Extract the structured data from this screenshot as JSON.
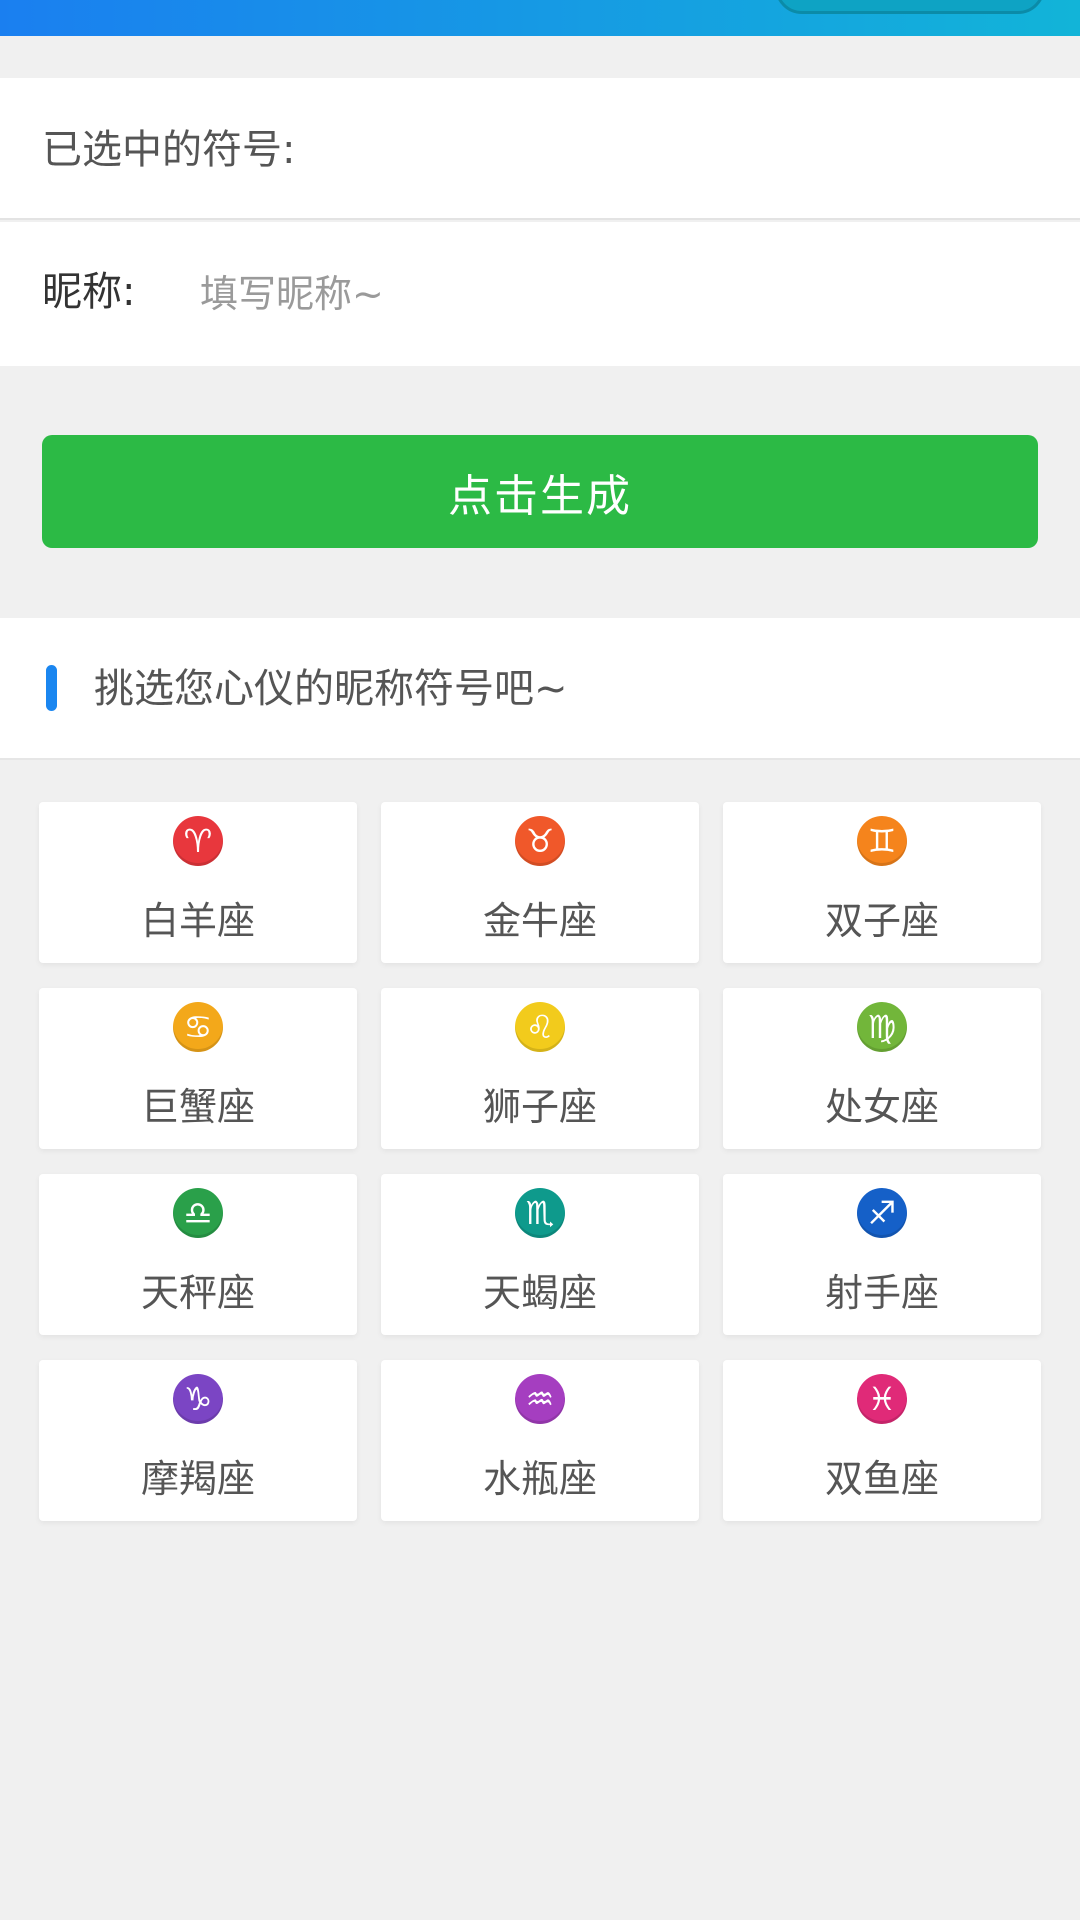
{
  "form": {
    "selected_label": "已选中的符号:",
    "nickname_label": "昵称:",
    "nickname_value": "",
    "nickname_placeholder": "填写昵称~",
    "generate_label": "点击生成"
  },
  "picker": {
    "title": "挑选您心仪的昵称符号吧~",
    "accent_color": "#1a86f0",
    "signs": [
      {
        "label": "白羊座",
        "glyph": "♈",
        "color": "#e8373d",
        "icon": "aries-icon"
      },
      {
        "label": "金牛座",
        "glyph": "♉",
        "color": "#f0582a",
        "icon": "taurus-icon"
      },
      {
        "label": "双子座",
        "glyph": "♊",
        "color": "#f5841c",
        "icon": "gemini-icon"
      },
      {
        "label": "巨蟹座",
        "glyph": "♋",
        "color": "#f3a81a",
        "icon": "cancer-icon"
      },
      {
        "label": "狮子座",
        "glyph": "♌",
        "color": "#f2cb1c",
        "icon": "leo-icon"
      },
      {
        "label": "处女座",
        "glyph": "♍",
        "color": "#72b63a",
        "icon": "virgo-icon"
      },
      {
        "label": "天秤座",
        "glyph": "♎",
        "color": "#2aa04a",
        "icon": "libra-icon"
      },
      {
        "label": "天蝎座",
        "glyph": "♏",
        "color": "#0e9a8c",
        "icon": "scorpio-icon"
      },
      {
        "label": "射手座",
        "glyph": "♐",
        "color": "#1560c8",
        "icon": "sagittarius-icon"
      },
      {
        "label": "摩羯座",
        "glyph": "♑",
        "color": "#7b45c4",
        "icon": "capricorn-icon"
      },
      {
        "label": "水瓶座",
        "glyph": "♒",
        "color": "#a53ec0",
        "icon": "aquarius-icon"
      },
      {
        "label": "双鱼座",
        "glyph": "♓",
        "color": "#e02a78",
        "icon": "pisces-icon"
      }
    ]
  },
  "colors": {
    "button": "#2cba45",
    "topbar_start": "#1a7ff0",
    "topbar_end": "#12b4d8"
  }
}
